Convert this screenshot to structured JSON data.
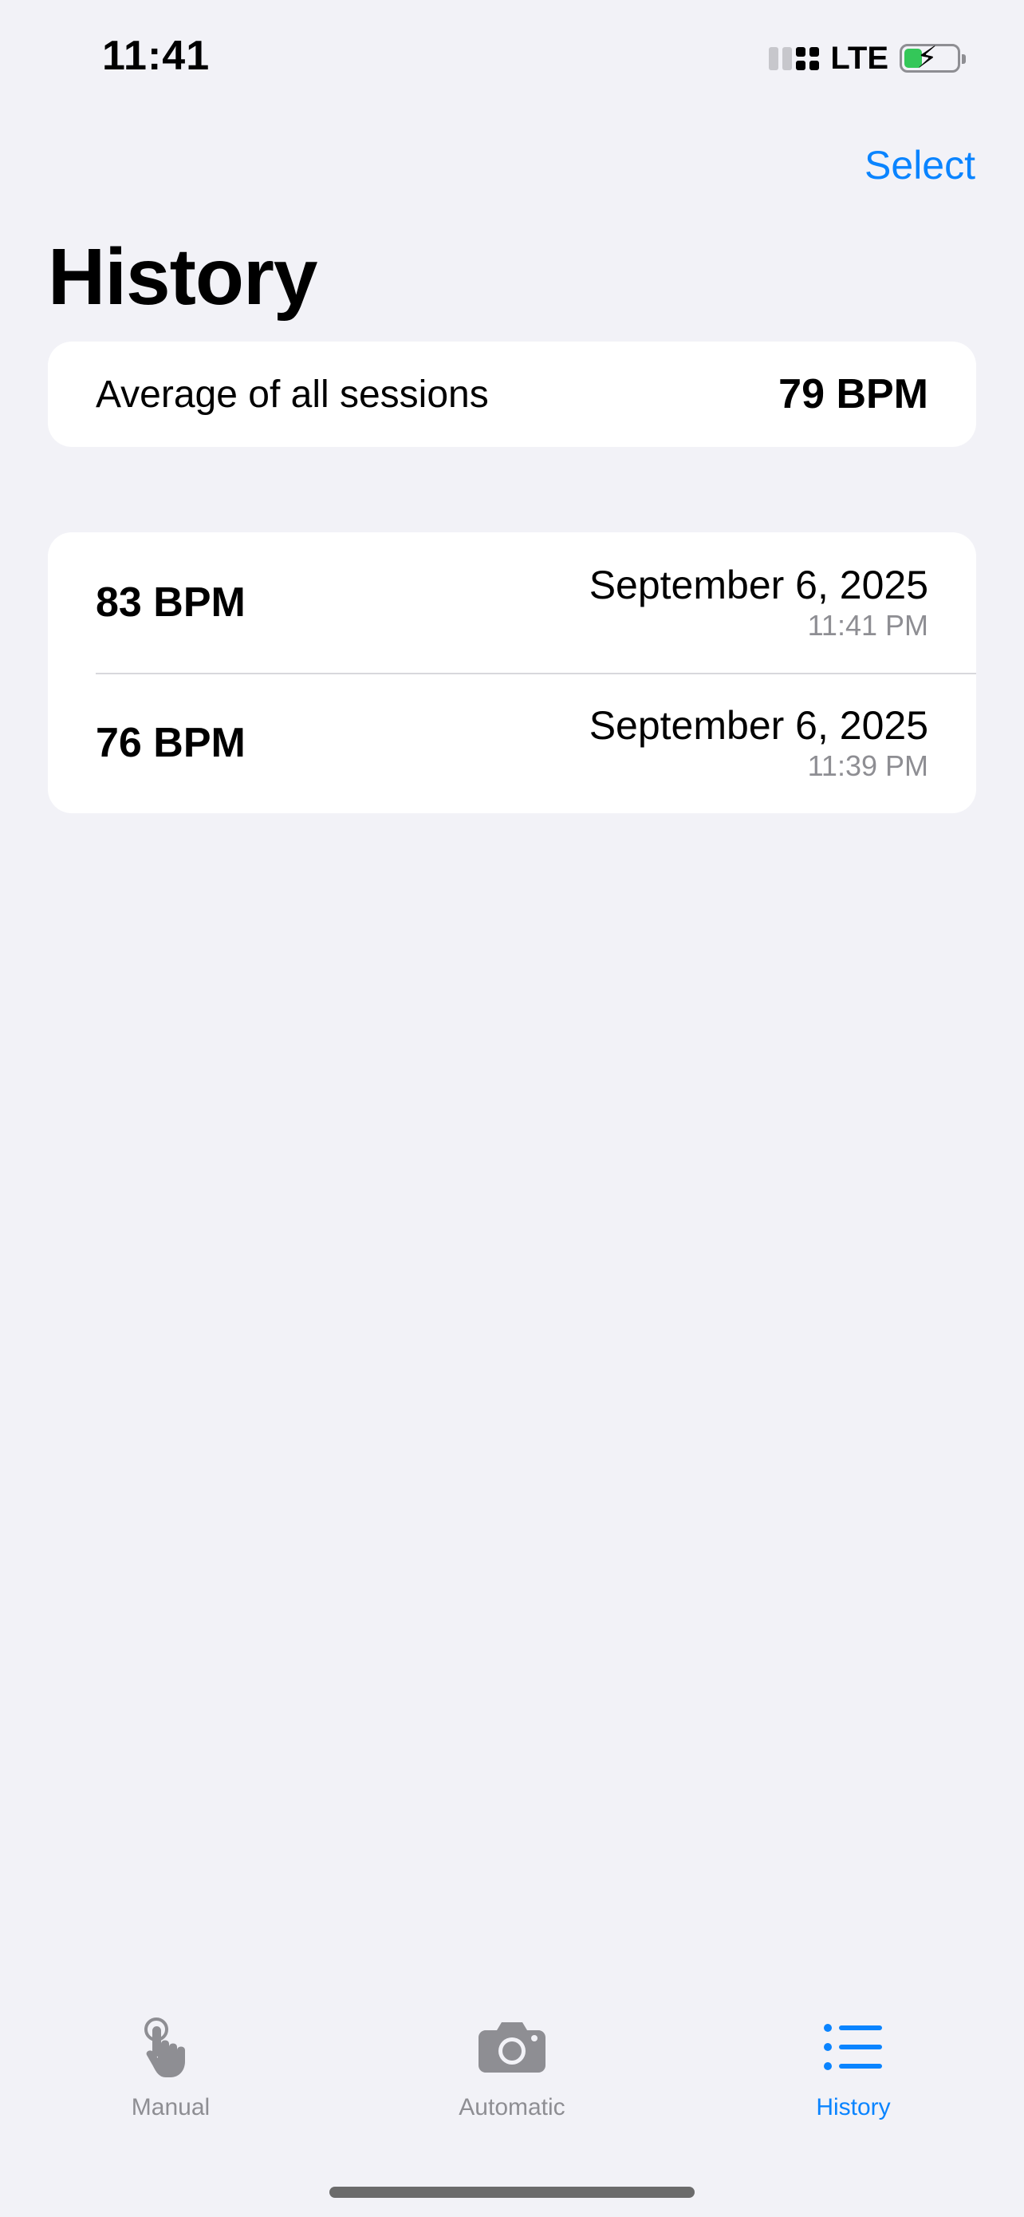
{
  "status_bar": {
    "time": "11:41",
    "network": "LTE",
    "battery_level": 0.35,
    "charging": true
  },
  "nav": {
    "select_label": "Select",
    "title": "History"
  },
  "average": {
    "label": "Average of all sessions",
    "value": "79 BPM"
  },
  "sessions": [
    {
      "bpm": "83 BPM",
      "date": "September 6, 2025",
      "time": "11:41 PM"
    },
    {
      "bpm": "76 BPM",
      "date": "September 6, 2025",
      "time": "11:39 PM"
    }
  ],
  "tab_bar": {
    "tabs": [
      {
        "label": "Manual",
        "icon": "hand-tap-icon",
        "active": false
      },
      {
        "label": "Automatic",
        "icon": "camera-icon",
        "active": false
      },
      {
        "label": "History",
        "icon": "list-icon",
        "active": true
      }
    ]
  },
  "colors": {
    "accent": "#0a84ff",
    "background": "#f2f2f7",
    "inactive": "#8e8e93",
    "battery": "#34c759"
  }
}
